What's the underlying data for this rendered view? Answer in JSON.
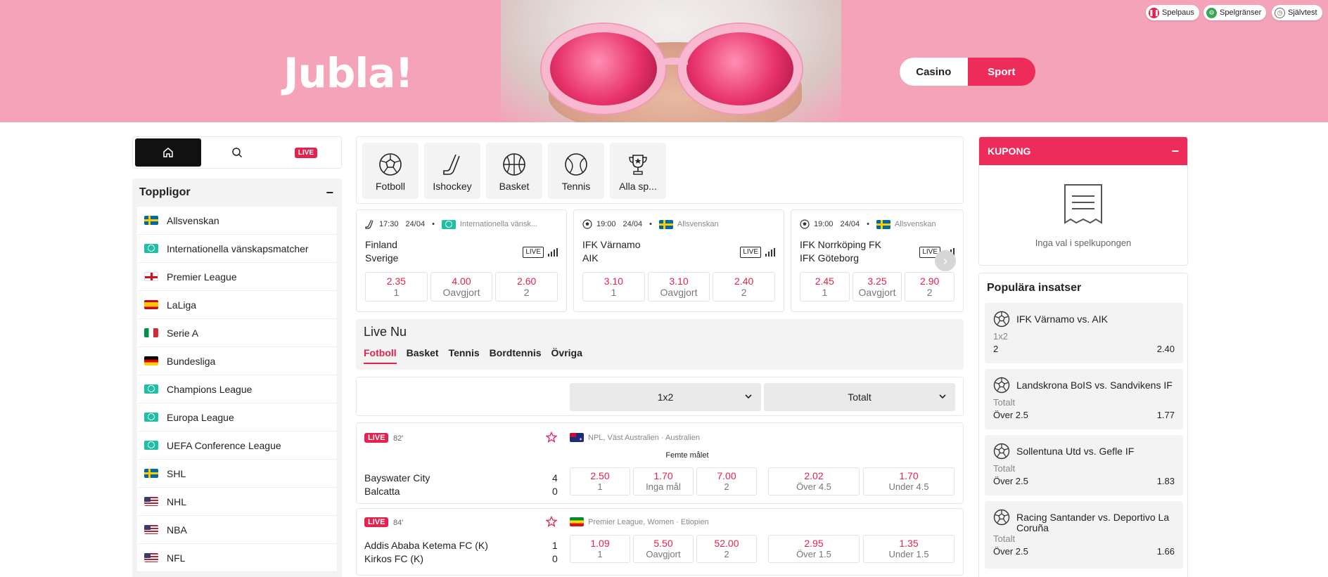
{
  "header": {
    "logo": "Jubla!",
    "switch": {
      "casino": "Casino",
      "sport": "Sport"
    },
    "utils": [
      {
        "label": "Spelpaus",
        "color": "#e3224d"
      },
      {
        "label": "Spelgränser",
        "color": "#3aa655"
      },
      {
        "label": "Självtest",
        "color": "#666666"
      }
    ]
  },
  "leftnav": {
    "live": "LIVE"
  },
  "toppligor": {
    "title": "Toppligor",
    "leagues": [
      {
        "name": "Allsvenskan",
        "flag": "se"
      },
      {
        "name": "Internationella vänskapsmatcher",
        "flag": "world"
      },
      {
        "name": "Premier League",
        "flag": "en"
      },
      {
        "name": "LaLiga",
        "flag": "es"
      },
      {
        "name": "Serie A",
        "flag": "it"
      },
      {
        "name": "Bundesliga",
        "flag": "de"
      },
      {
        "name": "Champions League",
        "flag": "world"
      },
      {
        "name": "Europa League",
        "flag": "world"
      },
      {
        "name": "UEFA Conference League",
        "flag": "world"
      },
      {
        "name": "SHL",
        "flag": "se"
      },
      {
        "name": "NHL",
        "flag": "us"
      },
      {
        "name": "NBA",
        "flag": "us"
      },
      {
        "name": "NFL",
        "flag": "us"
      }
    ]
  },
  "sports": [
    {
      "label": "Fotboll",
      "icon": "football-icon"
    },
    {
      "label": "Ishockey",
      "icon": "hockey-icon"
    },
    {
      "label": "Basket",
      "icon": "basketball-icon"
    },
    {
      "label": "Tennis",
      "icon": "tennis-icon"
    },
    {
      "label": "Alla sp...",
      "icon": "trophy-icon"
    }
  ],
  "events": [
    {
      "time": "17:30",
      "date": "24/04",
      "league": "Internationella vänsk...",
      "team1": "Finland",
      "team2": "Sverige",
      "live": "LIVE",
      "odds": [
        {
          "v": "2.35",
          "l": "1"
        },
        {
          "v": "4.00",
          "l": "Oavgjort"
        },
        {
          "v": "2.60",
          "l": "2"
        }
      ]
    },
    {
      "time": "19:00",
      "date": "24/04",
      "league": "Allsvenskan",
      "team1": "IFK Värnamo",
      "team2": "AIK",
      "live": "LIVE",
      "odds": [
        {
          "v": "3.10",
          "l": "1"
        },
        {
          "v": "3.10",
          "l": "Oavgjort"
        },
        {
          "v": "2.40",
          "l": "2"
        }
      ]
    },
    {
      "time": "19:00",
      "date": "24/04",
      "league": "Allsvenskan",
      "team1": "IFK Norrköping FK",
      "team2": "IFK Göteborg",
      "live": "LIVE",
      "odds": [
        {
          "v": "2.45",
          "l": "1"
        },
        {
          "v": "3.25",
          "l": "Oavgjort"
        },
        {
          "v": "2.90",
          "l": "2"
        }
      ]
    }
  ],
  "livenu": {
    "title": "Live Nu",
    "tabs": [
      "Fotboll",
      "Basket",
      "Tennis",
      "Bordtennis",
      "Övriga"
    ]
  },
  "markets": {
    "m1": "1x2",
    "m2": "Totalt"
  },
  "matches": [
    {
      "live": "LIVE",
      "minute": "82'",
      "league": "NPL, Väst Australien · Australien",
      "sub": "Femte målet",
      "team1": "Bayswater City",
      "team2": "Balcatta",
      "score1": "4",
      "score2": "0",
      "odds": [
        {
          "v": "2.50",
          "l": "1"
        },
        {
          "v": "1.70",
          "l": "Inga mål"
        },
        {
          "v": "7.00",
          "l": "2"
        }
      ],
      "totals": [
        {
          "v": "2.02",
          "l": "Över 4.5"
        },
        {
          "v": "1.70",
          "l": "Under 4.5"
        }
      ]
    },
    {
      "live": "LIVE",
      "minute": "84'",
      "league": "Premier League, Women · Etiopien",
      "sub": "",
      "team1": "Addis Ababa Ketema FC (K)",
      "team2": "Kirkos FC (K)",
      "score1": "1",
      "score2": "0",
      "odds": [
        {
          "v": "1.09",
          "l": "1"
        },
        {
          "v": "5.50",
          "l": "Oavgjort"
        },
        {
          "v": "52.00",
          "l": "2"
        }
      ],
      "totals": [
        {
          "v": "2.95",
          "l": "Över 1.5"
        },
        {
          "v": "1.35",
          "l": "Under 1.5"
        }
      ]
    }
  ],
  "kupong": {
    "title": "KUPONG",
    "empty": "Inga val i spelkupongen"
  },
  "popular": {
    "title": "Populära insatser",
    "bets": [
      {
        "match": "IFK Värnamo vs. AIK",
        "market": "1x2",
        "selection": "2",
        "odd": "2.40"
      },
      {
        "match": "Landskrona BoIS vs. Sandvikens IF",
        "market": "Totalt",
        "selection": "Över 2.5",
        "odd": "1.77"
      },
      {
        "match": "Sollentuna Utd vs. Gefle IF",
        "market": "Totalt",
        "selection": "Över 2.5",
        "odd": "1.83"
      },
      {
        "match": "Racing Santander vs. Deportivo La Coruña",
        "market": "Totalt",
        "selection": "Över 2.5",
        "odd": "1.66"
      }
    ]
  }
}
